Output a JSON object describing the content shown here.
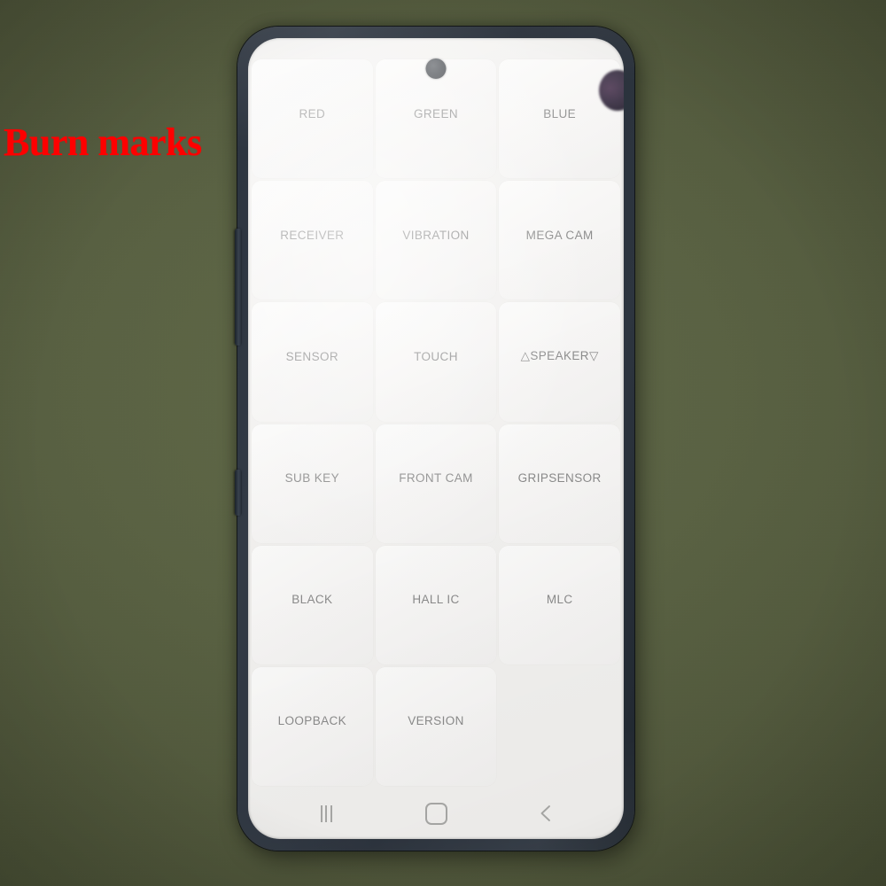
{
  "scene": {
    "kind": "photo-of-phone-screen",
    "background_color": "#586041",
    "phone_body_color": "#2b333e",
    "screen_background_color": "#f2f1ef"
  },
  "annotation": {
    "label": "Burn marks",
    "label_color": "#fe0000",
    "arrow_name": "burn-mark-arrow",
    "defect_name": "burn-mark-blob",
    "defect_color": "#362a40"
  },
  "device": {
    "camera_icon": "punch-hole-camera",
    "volume_button": "volume-rocker",
    "power_button": "power-button"
  },
  "screen": {
    "app": "service-mode-test-grid",
    "button_text_color": "#8b8b8b",
    "button_face_color": "#faf9f8",
    "grid": {
      "columns": 3,
      "rows": 6,
      "buttons": [
        {
          "label": "RED",
          "name": "test-button-red"
        },
        {
          "label": "GREEN",
          "name": "test-button-green"
        },
        {
          "label": "BLUE",
          "name": "test-button-blue"
        },
        {
          "label": "RECEIVER",
          "name": "test-button-receiver"
        },
        {
          "label": "VIBRATION",
          "name": "test-button-vibration"
        },
        {
          "label": "MEGA CAM",
          "name": "test-button-mega-cam"
        },
        {
          "label": "SENSOR",
          "name": "test-button-sensor"
        },
        {
          "label": "TOUCH",
          "name": "test-button-touch"
        },
        {
          "label": "△SPEAKER▽",
          "name": "test-button-speaker"
        },
        {
          "label": "SUB KEY",
          "name": "test-button-sub-key"
        },
        {
          "label": "FRONT CAM",
          "name": "test-button-front-cam"
        },
        {
          "label": "GRIPSENSOR",
          "name": "test-button-gripsensor"
        },
        {
          "label": "BLACK",
          "name": "test-button-black"
        },
        {
          "label": "HALL IC",
          "name": "test-button-hall-ic"
        },
        {
          "label": "MLC",
          "name": "test-button-mlc"
        },
        {
          "label": "LOOPBACK",
          "name": "test-button-loopback"
        },
        {
          "label": "VERSION",
          "name": "test-button-version"
        },
        {
          "label": "",
          "name": "test-grid-empty-cell"
        }
      ]
    }
  },
  "navigation_bar": {
    "icon_color": "#a9a9a7",
    "items": [
      {
        "name": "nav-recents-button",
        "icon": "recents-icon",
        "label": "Recents"
      },
      {
        "name": "nav-home-button",
        "icon": "home-icon",
        "label": "Home"
      },
      {
        "name": "nav-back-button",
        "icon": "back-chevron-icon",
        "label": "Back"
      }
    ]
  }
}
